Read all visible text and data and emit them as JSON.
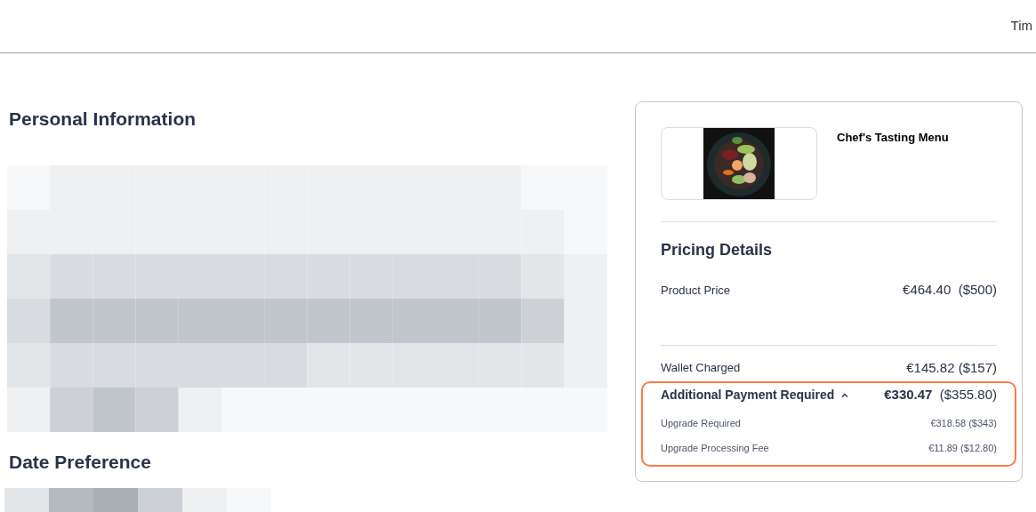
{
  "header": {
    "right_text": "Tim"
  },
  "sections": [
    {
      "title": "Personal Information"
    },
    {
      "title": "Date Preference"
    }
  ],
  "summary": {
    "product_title": "Chef's Tasting Menu",
    "pricing_title": "Pricing Details",
    "product_price": {
      "label": "Product Price",
      "eur": "€464.40",
      "usd": "($500)"
    },
    "wallet": {
      "label": "Wallet Charged",
      "value": "€145.82 ($157)"
    },
    "additional": {
      "label": "Additional Payment Required",
      "expanded": true,
      "eur": "€330.47",
      "usd": "($355.80)",
      "items": [
        {
          "label": "Upgrade Required",
          "value": "€318.58 ($343)"
        },
        {
          "label": "Upgrade Processing Fee",
          "value": "€11.89 ($12.80)"
        }
      ]
    }
  }
}
